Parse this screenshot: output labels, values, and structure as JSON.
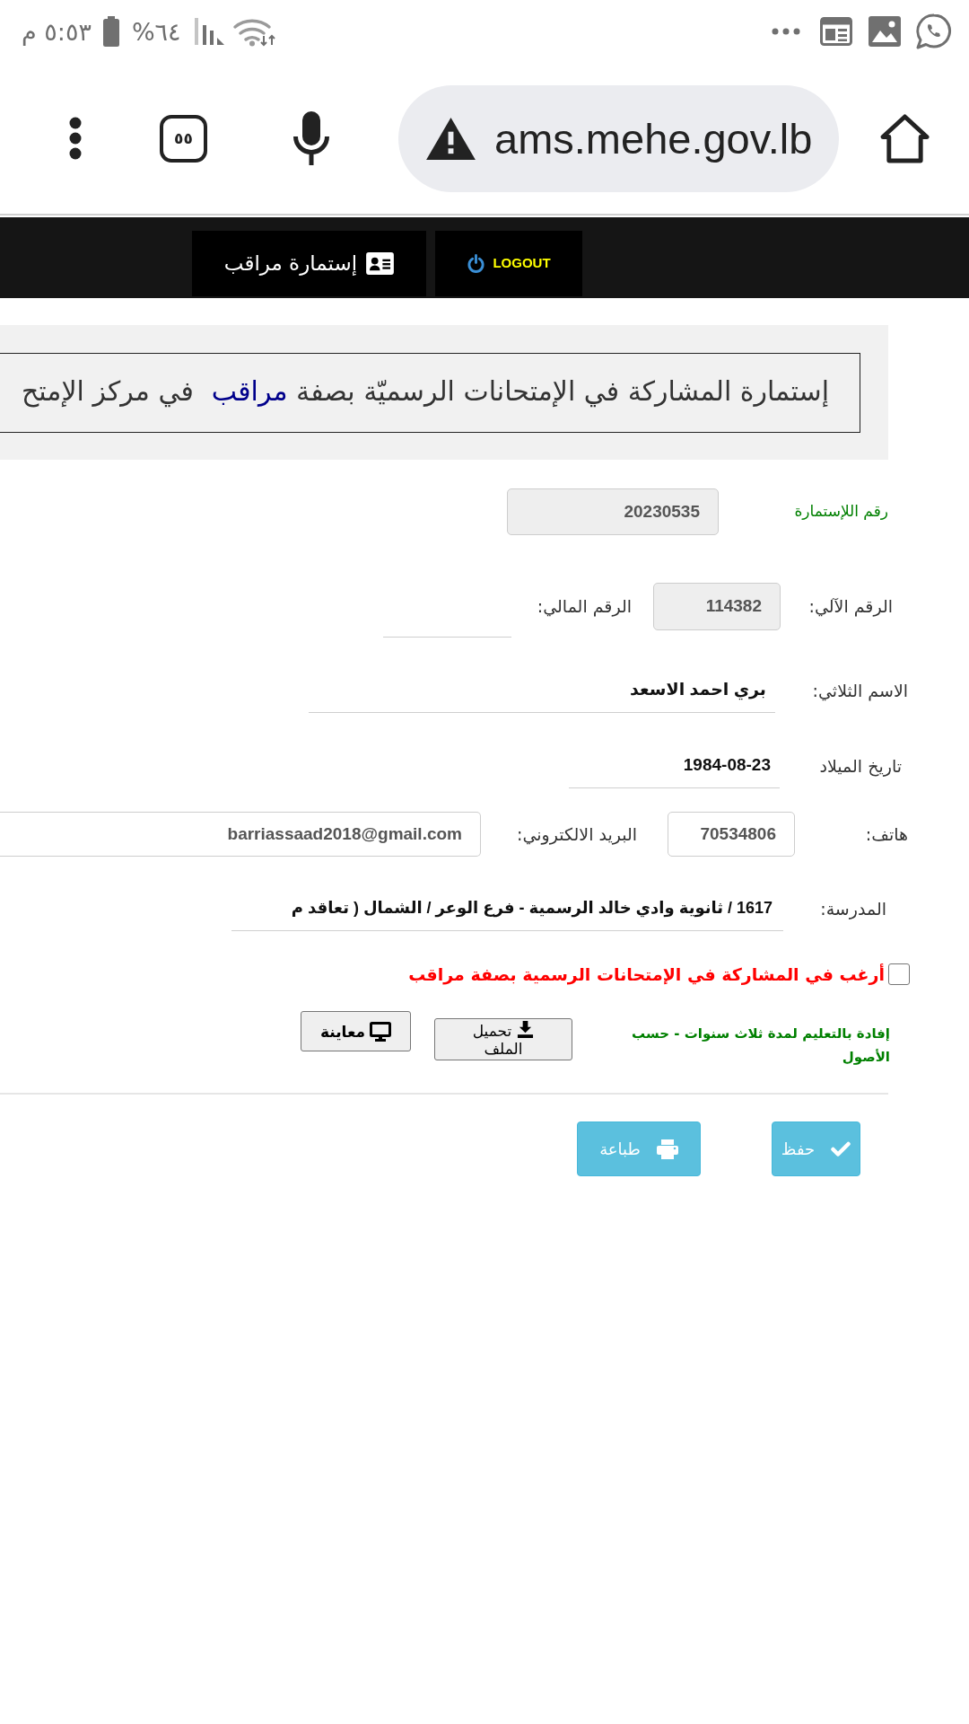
{
  "status_bar": {
    "time": "٥:٥٣ م",
    "battery": "%٦٤"
  },
  "browser": {
    "tab_count": "٥٥",
    "url": "ams.mehe.gov.lb"
  },
  "nav": [
    {
      "kind": "logout",
      "label": "LOGOUT"
    },
    {
      "kind": "form",
      "label": "إستمارة مراقب"
    }
  ],
  "banner": {
    "text": "إستمارة المشاركة في الإمتحانات الرسميّة بصفة",
    "highlight": "مراقب",
    "text_end": "في مركز الإمتح"
  },
  "form": {
    "rows": [
      {
        "fields": [
          {
            "label": "رقم اللإستمارة",
            "kind": "serial",
            "value": "20230535"
          }
        ]
      },
      {
        "fields": [
          {
            "label": "الرقم الآلي:",
            "kind": "readonly",
            "value": "114382"
          },
          {
            "label": "الرقم المالي:",
            "kind": "line"
          }
        ]
      },
      {
        "fields": [
          {
            "label": "الاسم الثلاثي:",
            "kind": "line",
            "value": "بري احمد الاسعد"
          }
        ]
      },
      {
        "fields": [
          {
            "label": "تاريخ الميلاد",
            "kind": "line",
            "value": "1984-08-23"
          }
        ]
      },
      {
        "fields": [
          {
            "label": "هاتف:",
            "kind": "box",
            "value": "70534806"
          },
          {
            "label": "البريد الالكتروني:",
            "kind": "box",
            "value": "barriassaad2018@gmail.com"
          }
        ]
      },
      {
        "fields": [
          {
            "label": "المدرسة:",
            "kind": "line",
            "value": "1617 / ثانوية وادي خالد الرسمية - فرع الوعر / الشمال ( تعاقد م"
          }
        ]
      }
    ],
    "consent": {
      "checked": false,
      "label": "أرغب في المشاركة في الإمتحانات الرسمية بصفة مراقب"
    },
    "attachment": {
      "label": "إفادة بالتعليم لمدة ثلاث سنوات - حسب الأصول",
      "upload": "تحميل الملف",
      "preview": "معاينة"
    }
  },
  "actions": [
    {
      "kind": "save",
      "label": "حفظ"
    },
    {
      "kind": "print",
      "label": "طباعة"
    }
  ]
}
